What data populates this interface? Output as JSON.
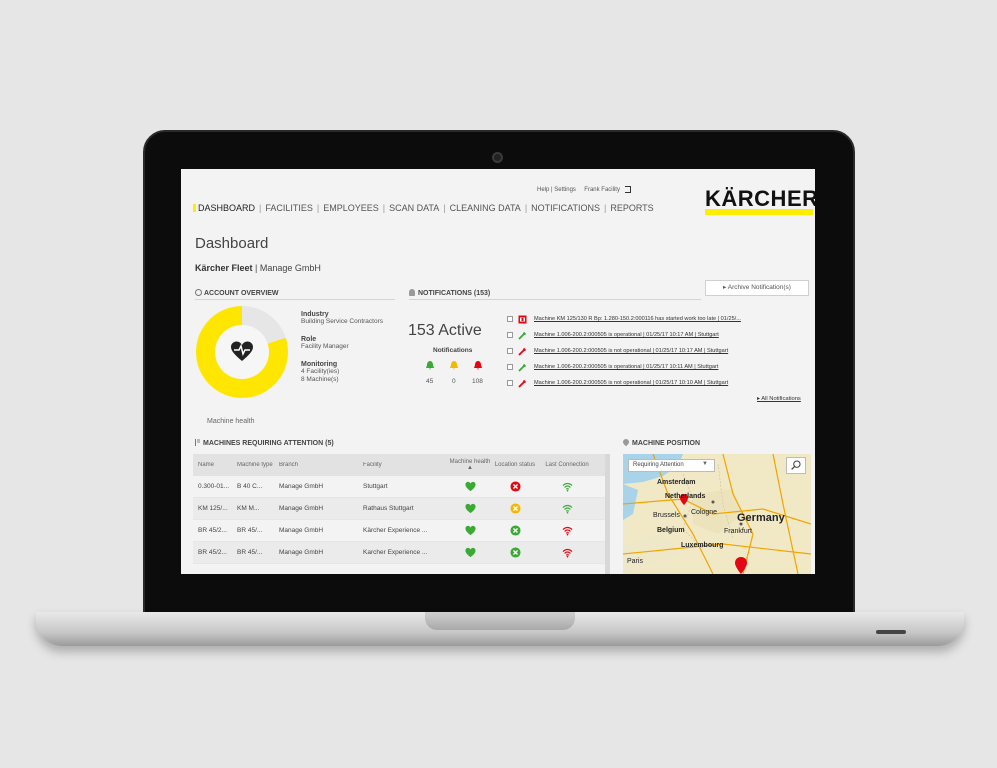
{
  "brand": {
    "logo": "KÄRCHER",
    "accent": "#ffed00"
  },
  "utility": {
    "help": "Help",
    "settings": "Settings",
    "user": "Frank Facility"
  },
  "nav": {
    "items": [
      "DASHBOARD",
      "FACILITIES",
      "EMPLOYEES",
      "SCAN DATA",
      "CLEANING DATA",
      "NOTIFICATIONS",
      "REPORTS"
    ],
    "active": "DASHBOARD"
  },
  "page": {
    "title": "Dashboard",
    "fleet": "Kärcher Fleet",
    "company": "Manage GmbH"
  },
  "account": {
    "heading": "ACCOUNT OVERVIEW",
    "machine_health_label": "Machine health",
    "machine_health_fraction": 0.8,
    "industry_label": "Industry",
    "industry_value": "Building Service Contractors",
    "role_label": "Role",
    "role_value": "Facility Manager",
    "monitoring_label": "Monitoring",
    "facilities": "4  Facility(ies)",
    "machines": "8  Machine(s)"
  },
  "notifications": {
    "heading": "NOTIFICATIONS (153)",
    "archive_label": "Archive Notification(s)",
    "active_text": "153 Active",
    "label": "Notifications",
    "counts": [
      {
        "value": "45",
        "color": "#3aaa35"
      },
      {
        "value": "0",
        "color": "#f5b800"
      },
      {
        "value": "108",
        "color": "#e30613"
      }
    ],
    "items": [
      {
        "icon": "alert-icon",
        "text": "Machine KM 125/130 R Bp: 1.280-150.2:000116 has started work too late | 01/25/..."
      },
      {
        "icon": "wrench-green-icon",
        "text": "Machine 1.006-200.2:000505 is operational | 01/25/17 10:17 AM | Stuttgart"
      },
      {
        "icon": "wrench-red-icon",
        "text": "Machine 1.006-200.2:000505 is not operational | 01/25/17 10:17 AM | Stuttgart"
      },
      {
        "icon": "wrench-green-icon",
        "text": "Machine 1.006-200.2:000505 is operational | 01/25/17 10:11 AM | Stuttgart"
      },
      {
        "icon": "wrench-red-icon",
        "text": "Machine 1.006-200.2:000505 is not operational | 01/25/17 10:10 AM | Stuttgart"
      }
    ],
    "all_link": "All Notifications"
  },
  "machines": {
    "heading": "MACHINES REQUIRING ATTENTION (5)",
    "columns": [
      "Name",
      "Machine type",
      "Branch",
      "Facility",
      "Machine health ▲",
      "Location status",
      "Last Connection"
    ],
    "rows": [
      {
        "name": "0.300-01...",
        "type": "B 40 C...",
        "branch": "Manage GmbH",
        "facility": "Stuttgart",
        "health": "ok",
        "location": "error",
        "connection": "good"
      },
      {
        "name": "KM 125/...",
        "type": "KM M...",
        "branch": "Manage GmbH",
        "facility": "Rathaus Stuttgart",
        "health": "ok",
        "location": "warning",
        "connection": "good"
      },
      {
        "name": "BR 45/2...",
        "type": "BR 45/...",
        "branch": "Manage GmbH",
        "facility": "Kärcher Experience ...",
        "health": "ok",
        "location": "ok",
        "connection": "bad"
      },
      {
        "name": "BR 45/2...",
        "type": "BR 45/...",
        "branch": "Manage GmbH",
        "facility": "Karcher Experience ...",
        "health": "ok",
        "location": "ok",
        "connection": "bad"
      }
    ]
  },
  "map": {
    "heading": "MACHINE POSITION",
    "filter": "Requiring Attention",
    "labels": [
      "Amsterdam",
      "Netherlands",
      "Brussels",
      "Cologne",
      "Germany",
      "Belgium",
      "Frankfurt",
      "Luxembourg",
      "Paris"
    ]
  },
  "colors": {
    "green": "#3aaa35",
    "red": "#e30613",
    "orange": "#f5b800",
    "yellow": "#ffe600"
  }
}
